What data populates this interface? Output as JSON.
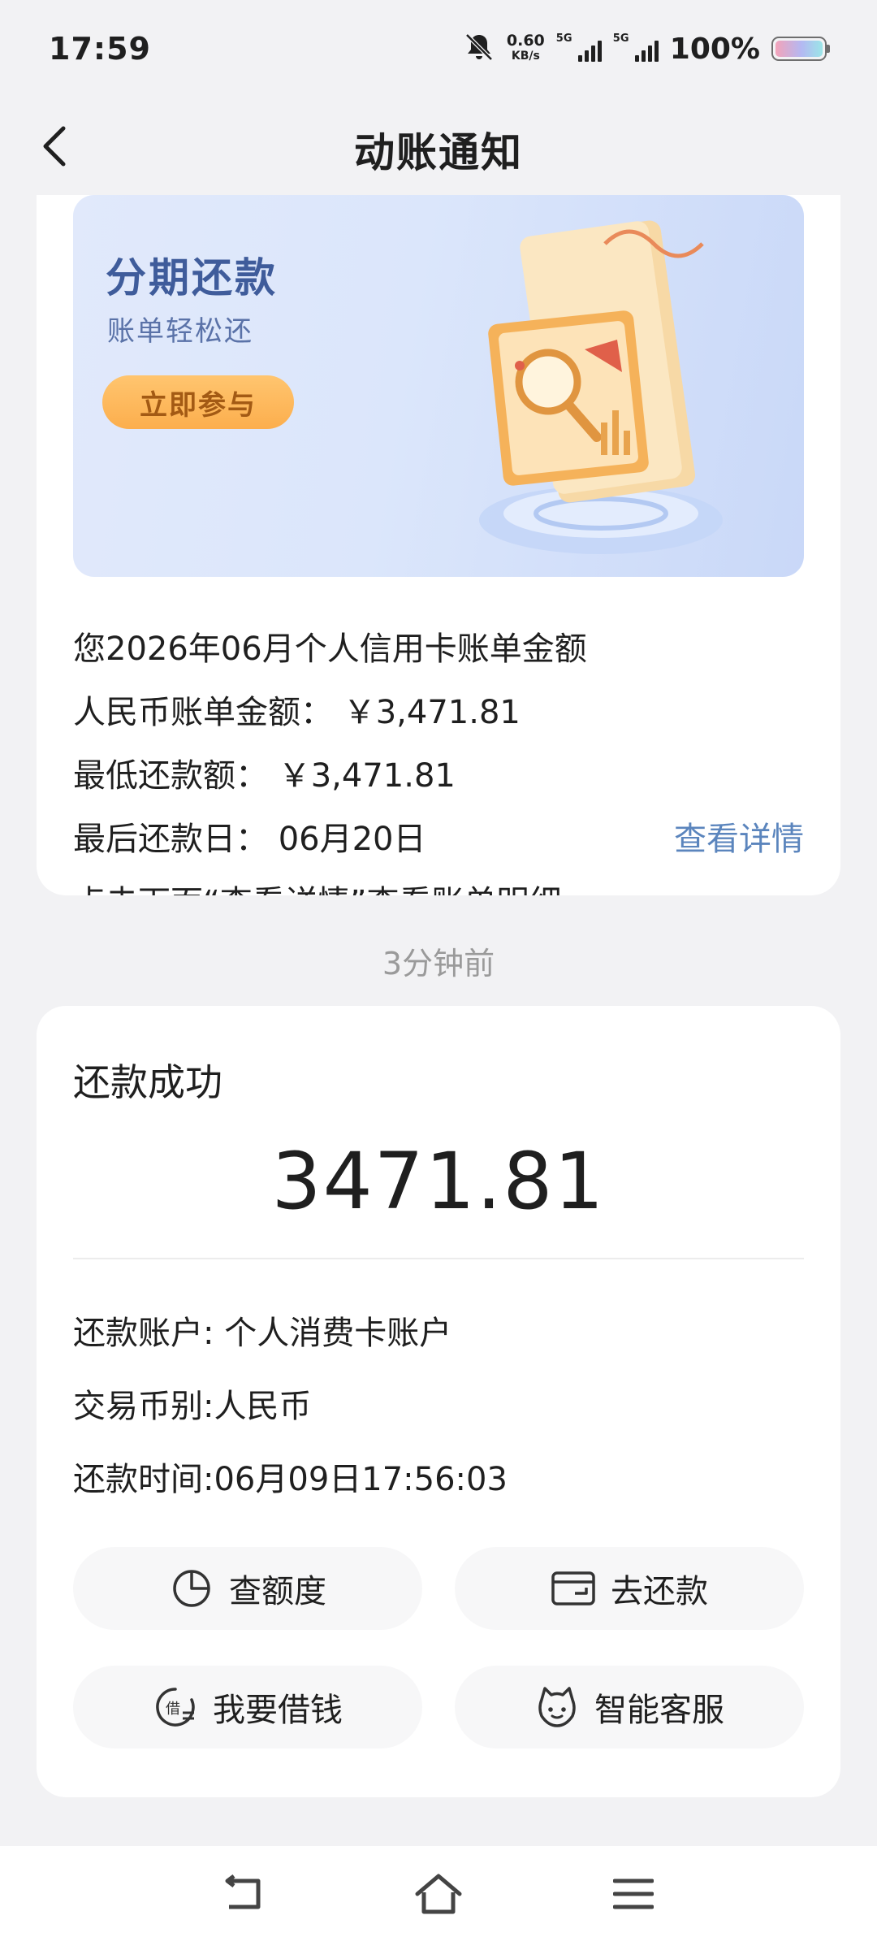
{
  "status_bar": {
    "time": "17:59",
    "speed_value": "0.60",
    "speed_unit": "KB/s",
    "sim1_label": "5G",
    "sim2_label": "5G",
    "battery_pct": "100%",
    "battery_level": 1.0,
    "icons": [
      "mute-bell-icon",
      "signal-icon",
      "battery-icon"
    ]
  },
  "header": {
    "title": "动账通知",
    "back_icon": "chevron-left-icon"
  },
  "bill_card": {
    "banner": {
      "title": "分期还款",
      "subtitle": "账单轻松还",
      "button_label": "立即参与"
    },
    "lines": [
      "您2026年06月个人信用卡账单金额",
      "人民币账单金额：  ￥3,471.81",
      "最低还款额：  ￥3,471.81",
      "最后还款日：  06月20日",
      "点击下面“查看详情”查看账单明细"
    ],
    "detail_link": "查看详情"
  },
  "timestamp": "3分钟前",
  "payment_card": {
    "title": "还款成功",
    "amount": "3471.81",
    "details": [
      "还款账户: 个人消费卡账户",
      "交易币别:人民币",
      "还款时间:06月09日17:56:03"
    ],
    "actions": [
      {
        "label": "查额度",
        "icon": "pie-chart-icon"
      },
      {
        "label": "去还款",
        "icon": "card-icon"
      },
      {
        "label": "我要借钱",
        "icon": "loan-icon"
      },
      {
        "label": "智能客服",
        "icon": "robot-icon"
      }
    ]
  },
  "nav_bar": {
    "icons": [
      "back-nav-icon",
      "home-icon",
      "menu-icon"
    ]
  },
  "colors": {
    "link": "#5b85bd",
    "banner_button": "#fcae4d",
    "banner_title": "#3f5c9b"
  }
}
